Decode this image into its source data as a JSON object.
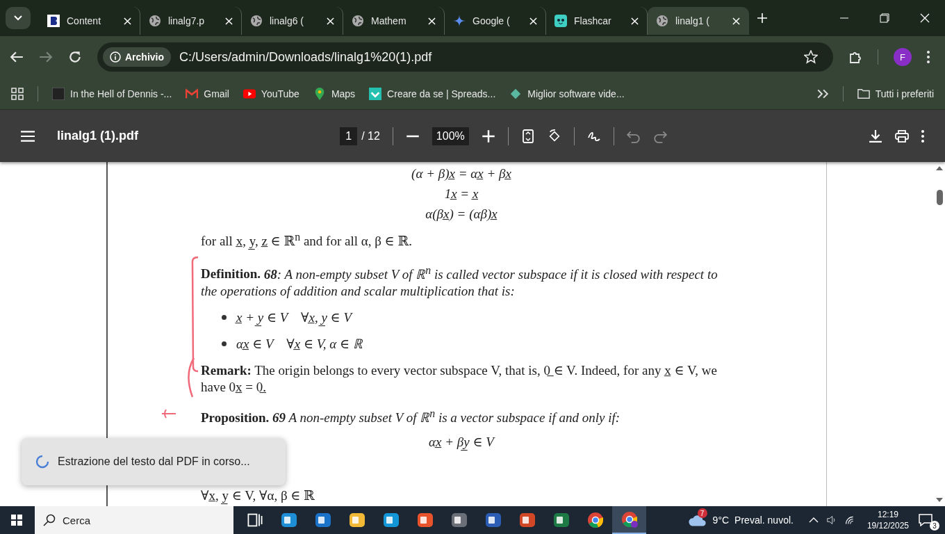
{
  "tabs": [
    {
      "title": "Content",
      "kind": "letter",
      "selected": false
    },
    {
      "title": "linalg7.p",
      "kind": "globe",
      "selected": false
    },
    {
      "title": "linalg6 (",
      "kind": "globe",
      "selected": false
    },
    {
      "title": "Mathem",
      "kind": "globe",
      "selected": false
    },
    {
      "title": "Google (",
      "kind": "sparkle",
      "selected": false
    },
    {
      "title": "Flashcar",
      "kind": "face",
      "selected": false
    },
    {
      "title": "linalg1 (",
      "kind": "globe",
      "selected": true
    }
  ],
  "address": {
    "chip": "Archivio",
    "url": "C:/Users/admin/Downloads/linalg1%20(1).pdf",
    "profile": "F"
  },
  "bookmarks": [
    {
      "label": "In the Hell of Dennis -...",
      "kind": "square"
    },
    {
      "label": "Gmail",
      "kind": "mail"
    },
    {
      "label": "YouTube",
      "kind": "play"
    },
    {
      "label": "Maps",
      "kind": "pin"
    },
    {
      "label": "Creare da se | Spreads...",
      "kind": "check"
    },
    {
      "label": "Miglior software vide...",
      "kind": "diamond"
    }
  ],
  "all_bookmarks": "Tutti i preferiti",
  "pdf_toolbar": {
    "title": "linalg1 (1).pdf",
    "page": "1",
    "total": "/ 12",
    "zoom": "100%"
  },
  "document": [
    {
      "kind": "equation",
      "text": "(α + β)x̲ = αx̲ + βx̲"
    },
    {
      "kind": "equation",
      "text": "1x̲ = x̲"
    },
    {
      "kind": "equation",
      "text": "α(βx̲) = (αβ)x̲"
    },
    {
      "kind": "paragraph",
      "text": "for all x̲, y̲, z̲ ∈ ℝ$^{n}$ and for all α, β ∈ ℝ."
    },
    {
      "kind": "theorem",
      "label": "Definition.",
      "italic": true,
      "text": "**68**: A non-empty subset V of ℝ$^{n}$ is called vector subspace if it is closed with respect to the operations of addition and scalar multiplication that is:",
      "bullets": [
        "x̲ + y̲ ∈ V    ∀x̲, y̲ ∈ V",
        "αx̲ ∈ V    ∀x̲ ∈ V, α ∈ ℝ"
      ]
    },
    {
      "kind": "theorem",
      "label": "Remark:",
      "italic": false,
      "text": "The origin belongs to every vector subspace V, that is, 0̲ ∈ V. Indeed, for any x̲ ∈ V, we have 0x̲ = 0̲."
    },
    {
      "kind": "theorem",
      "label": "Proposition.",
      "italic": true,
      "text": "**69** A non-empty subset V of ℝ$^{n}$ is a vector subspace if and only if:"
    },
    {
      "kind": "equation",
      "text": "αx̲ + βy̲ ∈ V"
    },
    {
      "kind": "paragraph",
      "text": "∀x̲, y̲ ∈ V, ∀α, β ∈ ℝ"
    }
  ],
  "toast": "Estrazione del testo dal PDF in corso...",
  "taskbar": {
    "search": "Cerca",
    "apps": [
      {
        "kind": "taskview",
        "selected": false
      },
      {
        "kind": "edge",
        "selected": false
      },
      {
        "kind": "outlook",
        "selected": false
      },
      {
        "kind": "files",
        "selected": false
      },
      {
        "kind": "skype",
        "selected": false
      },
      {
        "kind": "store",
        "selected": false
      },
      {
        "kind": "camera",
        "selected": false
      },
      {
        "kind": "word",
        "selected": false
      },
      {
        "kind": "powerpoint",
        "selected": false
      },
      {
        "kind": "excel",
        "selected": false
      },
      {
        "kind": "chrome",
        "selected": false
      },
      {
        "kind": "chrome-profile",
        "selected": true
      }
    ],
    "weather_badge": "7",
    "temperature": "9°C",
    "weather": "Preval. nuvol.",
    "time": "12:19",
    "date": "19/12/2025",
    "notifications": "3"
  }
}
